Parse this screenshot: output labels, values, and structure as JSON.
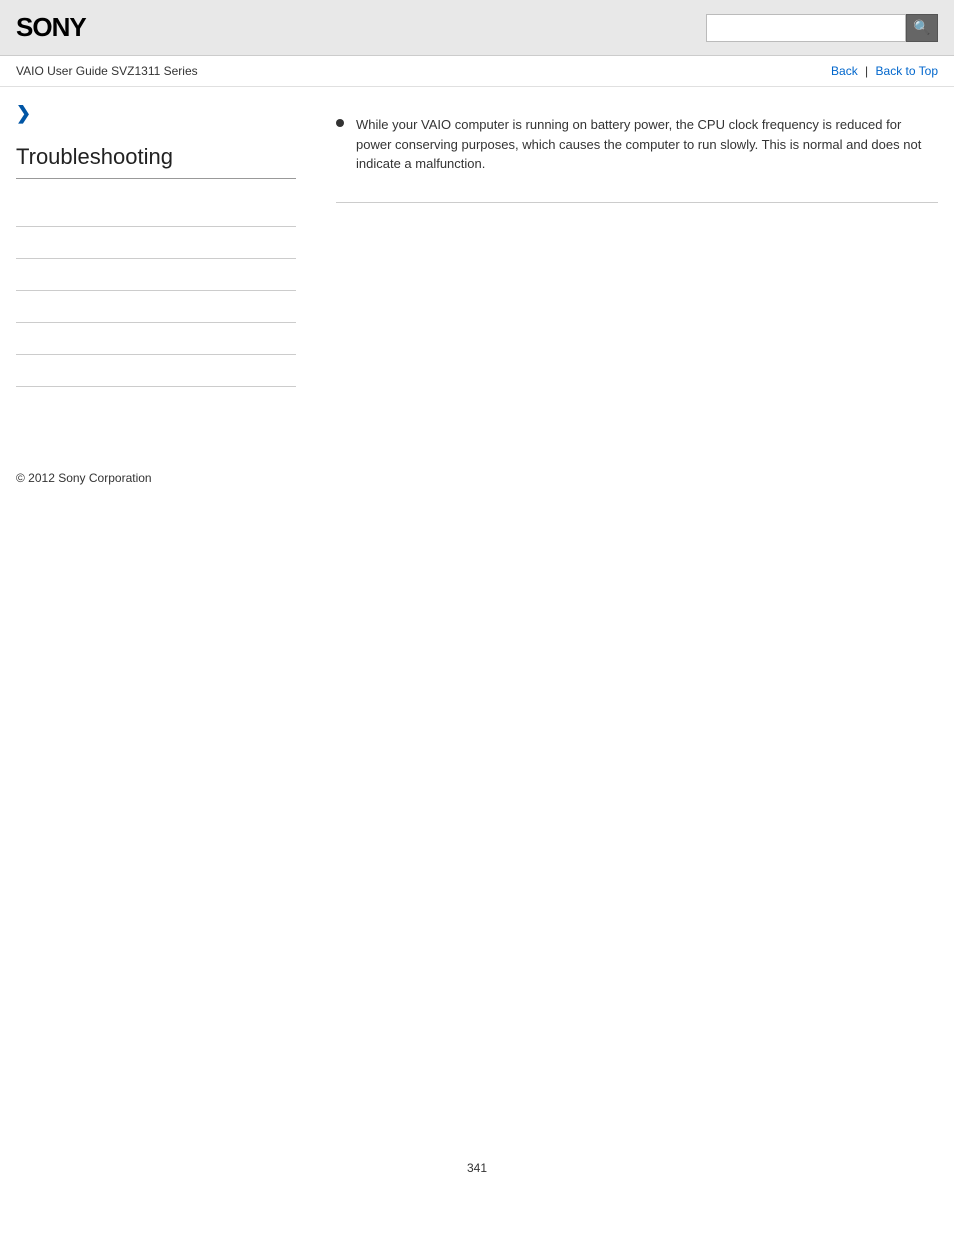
{
  "header": {
    "logo": "SONY",
    "search_placeholder": ""
  },
  "breadcrumb": {
    "text": "VAIO User Guide SVZ1311 Series",
    "back_label": "Back",
    "separator": "|",
    "back_to_top_label": "Back to Top"
  },
  "sidebar": {
    "expand_arrow": "❯",
    "section_title": "Troubleshooting",
    "links": [
      {
        "label": ""
      },
      {
        "label": ""
      },
      {
        "label": ""
      },
      {
        "label": ""
      },
      {
        "label": ""
      },
      {
        "label": ""
      },
      {
        "label": ""
      }
    ]
  },
  "content": {
    "bullet_text": "While your VAIO computer is running on battery power, the CPU clock frequency is reduced for power conserving purposes, which causes the computer to run slowly. This is normal and does not indicate a malfunction."
  },
  "footer": {
    "copyright": "© 2012 Sony Corporation"
  },
  "page_number": "341",
  "colors": {
    "link_color": "#0066cc",
    "header_bg": "#e8e8e8",
    "accent_blue": "#0055a5"
  }
}
